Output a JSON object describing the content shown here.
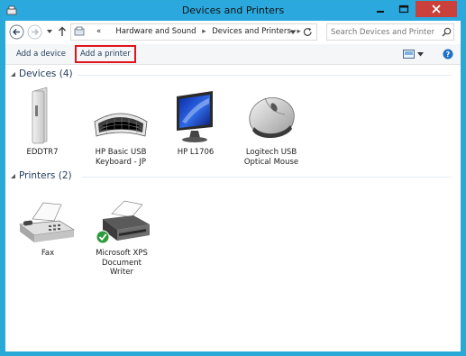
{
  "window": {
    "title": "Devices and Printers"
  },
  "address": {
    "prefix": "«",
    "crumbs": [
      "Hardware and Sound",
      "Devices and Printers"
    ]
  },
  "search": {
    "placeholder": "Search Devices and Printers"
  },
  "toolbar": {
    "add_device": "Add a device",
    "add_printer": "Add a printer"
  },
  "groups": {
    "devices": {
      "label": "Devices (4)",
      "items": [
        "EDDTR7",
        "HP Basic USB Keyboard - JP",
        "HP L1706",
        "Logitech USB Optical Mouse"
      ]
    },
    "printers": {
      "label": "Printers (2)",
      "items": [
        "Fax",
        "Microsoft XPS Document Writer"
      ]
    }
  },
  "colors": {
    "accent": "#2ba8dd",
    "close": "#c9413a",
    "highlight": "#e0141e",
    "header_text": "#1e395b"
  }
}
